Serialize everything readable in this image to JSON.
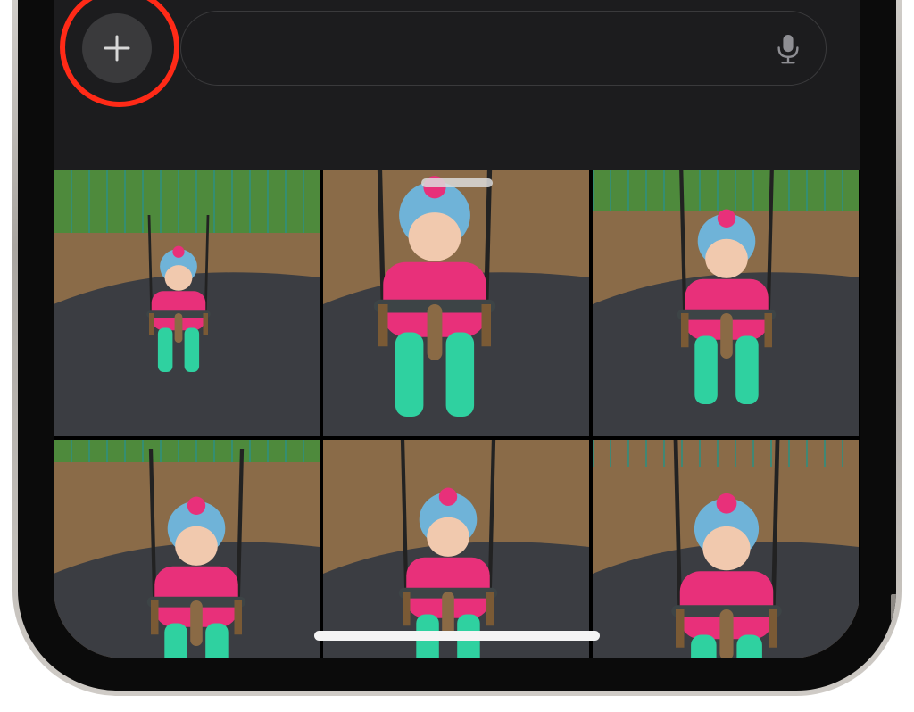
{
  "composer": {
    "add_button_icon": "plus-icon",
    "message_placeholder": "",
    "mic_icon": "microphone-icon"
  },
  "photo_picker": {
    "photos": [
      {
        "label": "photo-1"
      },
      {
        "label": "photo-2"
      },
      {
        "label": "photo-3"
      },
      {
        "label": "photo-4"
      },
      {
        "label": "photo-5"
      },
      {
        "label": "photo-6"
      }
    ]
  },
  "colors": {
    "highlight_ring": "#ff2a17",
    "screen_bg": "#1c1c1e",
    "button_bg": "#3a3a3c",
    "jacket": "#e8307a",
    "pants": "#2fd1a0",
    "hat": "#6fb3d8"
  }
}
